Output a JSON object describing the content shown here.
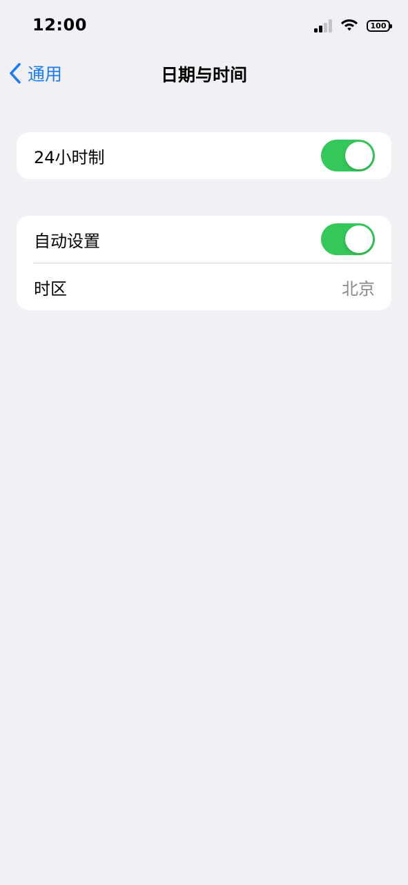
{
  "status_bar": {
    "time": "12:00",
    "battery_level": "100",
    "icons": [
      "cellular-signal-icon",
      "wifi-icon",
      "battery-icon"
    ]
  },
  "nav": {
    "back_label": "通用",
    "title": "日期与时间",
    "back_icon": "chevron-left-icon"
  },
  "settings": {
    "hour24": {
      "label": "24小时制",
      "enabled": true
    },
    "auto_set": {
      "label": "自动设置",
      "enabled": true
    },
    "timezone": {
      "label": "时区",
      "value": "北京"
    }
  },
  "colors": {
    "accent": "#1A7CF5",
    "toggle_on": "#34C759",
    "background": "#F0F0F5",
    "secondary_text": "#8A8A8E"
  }
}
